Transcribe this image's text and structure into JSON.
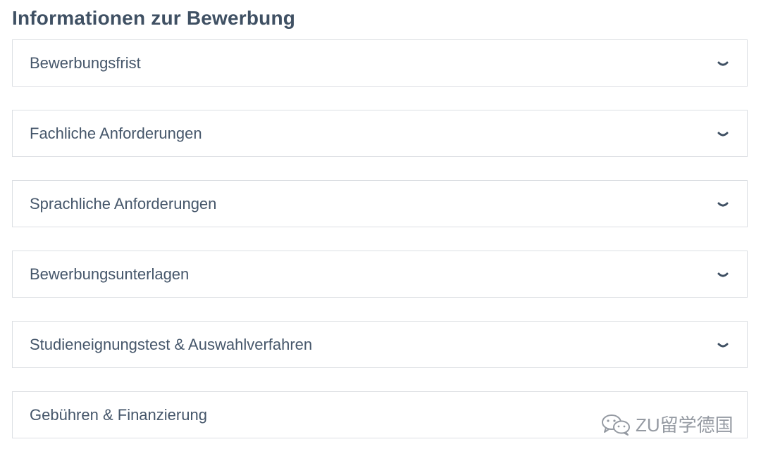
{
  "page": {
    "title": "Informationen zur Bewerbung"
  },
  "accordion": {
    "items": [
      {
        "label": "Bewerbungsfrist",
        "icon": "chevron-down-icon"
      },
      {
        "label": "Fachliche Anforderungen",
        "icon": "chevron-down-icon"
      },
      {
        "label": "Sprachliche Anforderungen",
        "icon": "chevron-down-icon"
      },
      {
        "label": "Bewerbungsunterlagen",
        "icon": "chevron-down-icon"
      },
      {
        "label": "Studieneignungstest & Auswahlverfahren",
        "icon": "chevron-down-icon"
      },
      {
        "label": "Gebühren & Finanzierung",
        "icon": "chevron-down-icon"
      }
    ]
  },
  "watermark": {
    "text": "ZU留学德国",
    "icon": "wechat-icon"
  },
  "colors": {
    "text": "#3f5063",
    "border": "#dcdfe3",
    "background": "#ffffff"
  }
}
